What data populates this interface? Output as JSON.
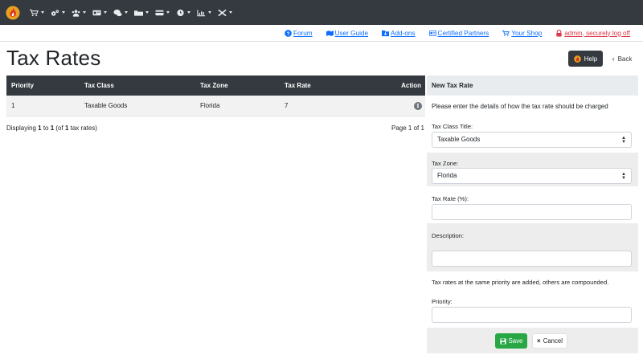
{
  "navbar": {
    "items": [
      {
        "icon": "cart-icon"
      },
      {
        "icon": "gears-icon"
      },
      {
        "icon": "users-icon"
      },
      {
        "icon": "modules-icon"
      },
      {
        "icon": "tools-icon"
      },
      {
        "icon": "folder-icon"
      },
      {
        "icon": "payment-icon"
      },
      {
        "icon": "clock-icon"
      },
      {
        "icon": "reports-icon"
      },
      {
        "icon": "wrench-icon"
      }
    ]
  },
  "links": {
    "forum": "Forum",
    "user_guide": "User Guide",
    "addons": "Add-ons",
    "certified_partners": "Certified Partners",
    "your_shop": "Your Shop",
    "logoff": "admin, securely log off"
  },
  "page": {
    "title": "Tax Rates",
    "help": "Help",
    "back": "Back"
  },
  "table": {
    "headers": {
      "priority": "Priority",
      "tax_class": "Tax Class",
      "tax_zone": "Tax Zone",
      "tax_rate": "Tax Rate",
      "action": "Action"
    },
    "rows": [
      {
        "priority": "1",
        "tax_class": "Taxable Goods",
        "tax_zone": "Florida",
        "tax_rate": "7"
      }
    ],
    "displaying": {
      "prefix": "Displaying ",
      "from": "1",
      "to_word": " to ",
      "to": "1",
      "of_pre": " (of ",
      "total": "1",
      "suffix": " tax rates)"
    },
    "page_info": "Page 1 of 1"
  },
  "panel": {
    "heading": "New Tax Rate",
    "note": "Please enter the details of how the tax rate should be charged",
    "tax_class_label": "Tax Class Title:",
    "tax_class_value": "Taxable Goods",
    "tax_zone_label": "Tax Zone:",
    "tax_zone_value": "Florida",
    "tax_rate_label": "Tax Rate (%):",
    "tax_rate_value": "",
    "description_label": "Description:",
    "description_value": "",
    "compound_note": "Tax rates at the same priority are added, others are compounded.",
    "priority_label": "Priority:",
    "priority_value": "",
    "save": "Save",
    "cancel": "Cancel"
  },
  "colors": {
    "navbar": "#343a40",
    "link": "#0d6efd",
    "danger": "#dc3545",
    "save": "#28a745"
  }
}
